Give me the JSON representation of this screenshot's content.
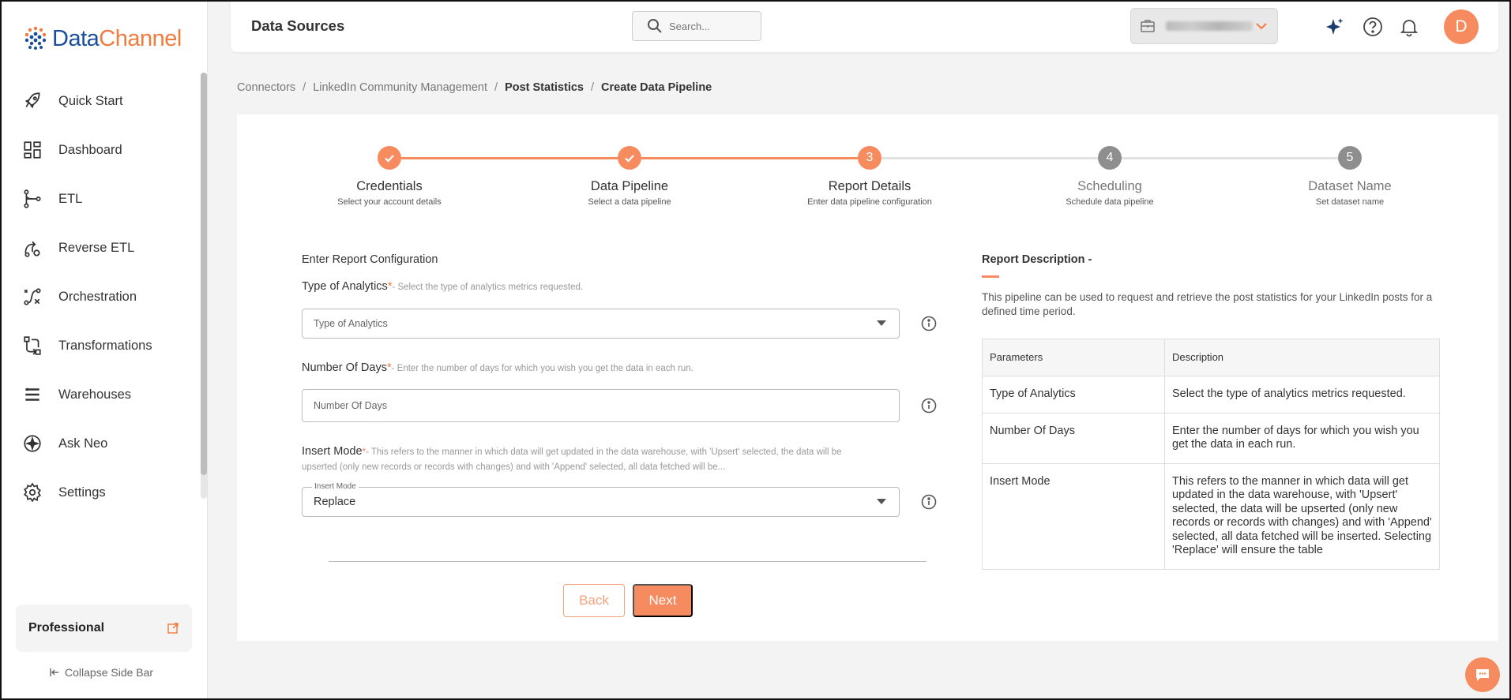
{
  "brand": {
    "name_part1": "Data",
    "name_part2": "Channel"
  },
  "sidebar": {
    "items": [
      {
        "label": "Quick Start",
        "icon": "rocket-icon"
      },
      {
        "label": "Dashboard",
        "icon": "dashboard-icon"
      },
      {
        "label": "ETL",
        "icon": "etl-icon"
      },
      {
        "label": "Reverse ETL",
        "icon": "reverse-etl-icon"
      },
      {
        "label": "Orchestration",
        "icon": "orchestration-icon"
      },
      {
        "label": "Transformations",
        "icon": "transformations-icon"
      },
      {
        "label": "Warehouses",
        "icon": "warehouses-icon"
      },
      {
        "label": "Ask Neo",
        "icon": "sparkle-icon"
      },
      {
        "label": "Settings",
        "icon": "gear-icon"
      }
    ],
    "plan": "Professional",
    "collapse_label": "Collapse Side Bar"
  },
  "header": {
    "title": "Data Sources",
    "search_placeholder": "Search...",
    "avatar_initial": "D"
  },
  "breadcrumb": [
    {
      "label": "Connectors"
    },
    {
      "label": "LinkedIn Community Management"
    },
    {
      "label": "Post Statistics"
    },
    {
      "label": "Create Data Pipeline"
    }
  ],
  "stepper": {
    "steps": [
      {
        "number": "1",
        "title": "Credentials",
        "subtitle": "Select your account details",
        "status": "done"
      },
      {
        "number": "2",
        "title": "Data Pipeline",
        "subtitle": "Select a data pipeline",
        "status": "done"
      },
      {
        "number": "3",
        "title": "Report Details",
        "subtitle": "Enter data pipeline configuration",
        "status": "active"
      },
      {
        "number": "4",
        "title": "Scheduling",
        "subtitle": "Schedule data pipeline",
        "status": "pending"
      },
      {
        "number": "5",
        "title": "Dataset Name",
        "subtitle": "Set dataset name",
        "status": "pending"
      }
    ]
  },
  "form": {
    "heading": "Enter Report Configuration",
    "type_of_analytics": {
      "label": "Type of Analytics",
      "required_mark": "*",
      "hint": "- Select the type of analytics metrics requested.",
      "placeholder": "Type of Analytics"
    },
    "number_of_days": {
      "label": "Number Of Days",
      "required_mark": "*",
      "hint": "- Enter the number of days for which you wish you get the data in each run.",
      "placeholder": "Number Of Days"
    },
    "insert_mode": {
      "label": "Insert Mode",
      "required_mark": "*",
      "hint": "- This refers to the manner in which data will get updated in the data warehouse, with 'Upsert' selected, the data will be upserted (only new records or records with changes) and with 'Append' selected, all data fetched will be...",
      "float_label": "Insert Mode",
      "value": "Replace"
    },
    "back_label": "Back",
    "next_label": "Next"
  },
  "description": {
    "title": "Report Description -",
    "text": "This pipeline can be used to request and retrieve the post statistics for your LinkedIn posts for a defined time period.",
    "table": {
      "headers": [
        "Parameters",
        "Description"
      ],
      "rows": [
        [
          "Type of Analytics",
          "Select the type of analytics metrics requested."
        ],
        [
          "Number Of Days",
          "Enter the number of days for which you wish you get the data in each run."
        ],
        [
          "Insert Mode",
          "This refers to the manner in which data will get updated in the data warehouse, with 'Upsert' selected, the data will be upserted (only new records or records with changes) and with 'Append' selected, all data fetched will be inserted. Selecting 'Replace' will ensure the table"
        ]
      ]
    }
  },
  "colors": {
    "accent": "#f58b5e",
    "brand_blue": "#1b4f9c",
    "pending": "#8e8e8e"
  }
}
